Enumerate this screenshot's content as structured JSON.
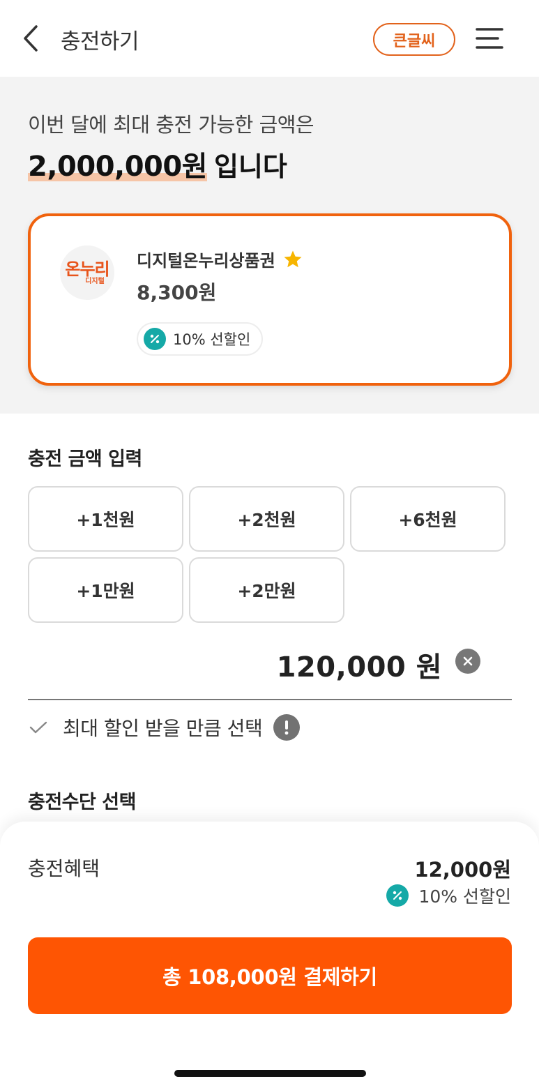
{
  "header": {
    "title": "충전하기",
    "big_font_label": "큰글씨"
  },
  "limit": {
    "line1": "이번 달에 최대 충전 가능한 금액은",
    "amount": "2,000,000원",
    "suffix": "입니다"
  },
  "voucher": {
    "logo_main": "온누리",
    "logo_sub": "디지털",
    "name": "디지털온누리상품권",
    "price": "8,300원",
    "discount": "10% 선할인"
  },
  "charge": {
    "section_title": "충전 금액 입력",
    "buttons": [
      "+1천원",
      "+2천원",
      "+6천원",
      "+1만원",
      "+2만원"
    ],
    "amount_value": "120,000 원",
    "max_discount_label": "최대 할인 받을 만큼 선택"
  },
  "method": {
    "section_title": "충전수단 선택"
  },
  "summary": {
    "benefit_label": "충전혜택",
    "benefit_amount": "12,000원",
    "benefit_discount": "10% 선할인",
    "pay_label": "총 108,000원 결제하기"
  },
  "colors": {
    "accent": "#fe5503",
    "card_border": "#f0620d",
    "badge_teal": "#15a9a7",
    "star": "#f7b500"
  }
}
